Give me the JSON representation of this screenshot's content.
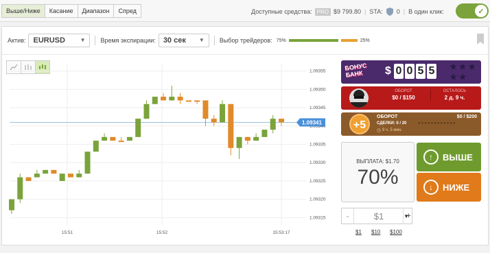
{
  "tabs": [
    "Выше/Ниже",
    "Касание",
    "Диапазон",
    "Спред"
  ],
  "funds": {
    "label": "Доступные средства:",
    "pro": "PRO",
    "amount": "$9 799.80",
    "sta_label": "STA:",
    "sta_value": "0",
    "oneclick_label": "В один клик:"
  },
  "controls": {
    "asset_label": "Актив:",
    "asset": "EURUSD",
    "expiry_label": "Время экспирации:",
    "expiry": "30 сек",
    "traders_label": "Выбор трейдеров:",
    "traders_up": "75%",
    "traders_down": "25%"
  },
  "chart_data": {
    "type": "candlestick",
    "x_ticks": [
      "15:51",
      "15:52",
      "15:53:17"
    ],
    "y_ticks": [
      "1.09355",
      "1.09350",
      "1.09345",
      "1.09340",
      "1.09335",
      "1.09330",
      "1.09325",
      "1.09320",
      "1.09315"
    ],
    "current_price": "1.09341",
    "candles": [
      {
        "o": 1.09317,
        "c": 1.0932,
        "h": 1.09319,
        "l": 1.09316,
        "dir": "up"
      },
      {
        "o": 1.0932,
        "c": 1.09326,
        "h": 1.09327,
        "l": 1.09319,
        "dir": "up"
      },
      {
        "o": 1.09326,
        "c": 1.09325,
        "h": 1.09326,
        "l": 1.09325,
        "dir": "down"
      },
      {
        "o": 1.09326,
        "c": 1.09327,
        "h": 1.09328,
        "l": 1.09326,
        "dir": "up"
      },
      {
        "o": 1.09327,
        "c": 1.09328,
        "h": 1.09328,
        "l": 1.09327,
        "dir": "up"
      },
      {
        "o": 1.09328,
        "c": 1.09327,
        "h": 1.09328,
        "l": 1.09327,
        "dir": "down"
      },
      {
        "o": 1.09325,
        "c": 1.09327,
        "h": 1.09327,
        "l": 1.09325,
        "dir": "up"
      },
      {
        "o": 1.09327,
        "c": 1.09326,
        "h": 1.09327,
        "l": 1.09326,
        "dir": "down"
      },
      {
        "o": 1.09326,
        "c": 1.09327,
        "h": 1.09328,
        "l": 1.09326,
        "dir": "up"
      },
      {
        "o": 1.09327,
        "c": 1.09333,
        "h": 1.09333,
        "l": 1.09327,
        "dir": "up"
      },
      {
        "o": 1.09333,
        "c": 1.09336,
        "h": 1.09336,
        "l": 1.09333,
        "dir": "up"
      },
      {
        "o": 1.09336,
        "c": 1.09337,
        "h": 1.09338,
        "l": 1.09336,
        "dir": "up"
      },
      {
        "o": 1.09337,
        "c": 1.09336,
        "h": 1.09337,
        "l": 1.09336,
        "dir": "down"
      },
      {
        "o": 1.09336,
        "c": 1.09336,
        "h": 1.09337,
        "l": 1.09336,
        "dir": "down"
      },
      {
        "o": 1.09336,
        "c": 1.09337,
        "h": 1.09337,
        "l": 1.09336,
        "dir": "up"
      },
      {
        "o": 1.09337,
        "c": 1.09342,
        "h": 1.09342,
        "l": 1.09337,
        "dir": "up"
      },
      {
        "o": 1.09342,
        "c": 1.09346,
        "h": 1.09347,
        "l": 1.09342,
        "dir": "up"
      },
      {
        "o": 1.09346,
        "c": 1.09348,
        "h": 1.09348,
        "l": 1.09346,
        "dir": "up"
      },
      {
        "o": 1.09348,
        "c": 1.09347,
        "h": 1.09349,
        "l": 1.09347,
        "dir": "down"
      },
      {
        "o": 1.09347,
        "c": 1.09348,
        "h": 1.09351,
        "l": 1.09347,
        "dir": "up"
      },
      {
        "o": 1.09348,
        "c": 1.09347,
        "h": 1.09349,
        "l": 1.09346,
        "dir": "down"
      },
      {
        "o": 1.09347,
        "c": 1.09347,
        "h": 1.09347,
        "l": 1.09347,
        "dir": "down"
      },
      {
        "o": 1.09347,
        "c": 1.09347,
        "h": 1.09347,
        "l": 1.09346,
        "dir": "down"
      },
      {
        "o": 1.09347,
        "c": 1.09342,
        "h": 1.09347,
        "l": 1.0934,
        "dir": "down"
      },
      {
        "o": 1.09342,
        "c": 1.09341,
        "h": 1.09343,
        "l": 1.0934,
        "dir": "down"
      },
      {
        "o": 1.09341,
        "c": 1.09346,
        "h": 1.09347,
        "l": 1.09341,
        "dir": "up"
      },
      {
        "o": 1.09346,
        "c": 1.09334,
        "h": 1.09346,
        "l": 1.09332,
        "dir": "down"
      },
      {
        "o": 1.09334,
        "c": 1.09337,
        "h": 1.09337,
        "l": 1.09331,
        "dir": "up"
      },
      {
        "o": 1.09337,
        "c": 1.09336,
        "h": 1.09337,
        "l": 1.09335,
        "dir": "down"
      },
      {
        "o": 1.09336,
        "c": 1.09337,
        "h": 1.09338,
        "l": 1.09336,
        "dir": "up"
      },
      {
        "o": 1.09337,
        "c": 1.09339,
        "h": 1.09339,
        "l": 1.09337,
        "dir": "up"
      },
      {
        "o": 1.09339,
        "c": 1.09342,
        "h": 1.09343,
        "l": 1.09338,
        "dir": "up"
      },
      {
        "o": 1.09342,
        "c": 1.09341,
        "h": 1.09342,
        "l": 1.0934,
        "dir": "down"
      }
    ],
    "ylim": [
      1.09313,
      1.09357
    ],
    "colors": {
      "up": "#7aa33b",
      "down": "#e08a2a"
    }
  },
  "bonus": {
    "title": "БОНУС БАНК",
    "amount_prefix": "$",
    "amount_digits": [
      "0",
      "0",
      "5",
      "5"
    ],
    "turnover_label": "ОБОРОТ",
    "turnover_value": "$0 / $150",
    "remaining_label": "ОСТАЛОСЬ",
    "remaining_value": "2 д. 9 ч.",
    "plus5": "+5",
    "turnover2_label": "ОБОРОТ",
    "turnover2_value": "$0 / $200",
    "deals_label": "СДЕЛКИ: 0 / 20",
    "time_left": "9 ч. 5 мин."
  },
  "payout": {
    "label": "ВЫПЛАТА: $1.70",
    "percent": "70%"
  },
  "buttons": {
    "up": "ВЫШЕ",
    "down": "НИЖЕ"
  },
  "amount": {
    "value": "$1",
    "minus": "-",
    "plus": "+",
    "quick": [
      "$1",
      "$10",
      "$100"
    ]
  }
}
